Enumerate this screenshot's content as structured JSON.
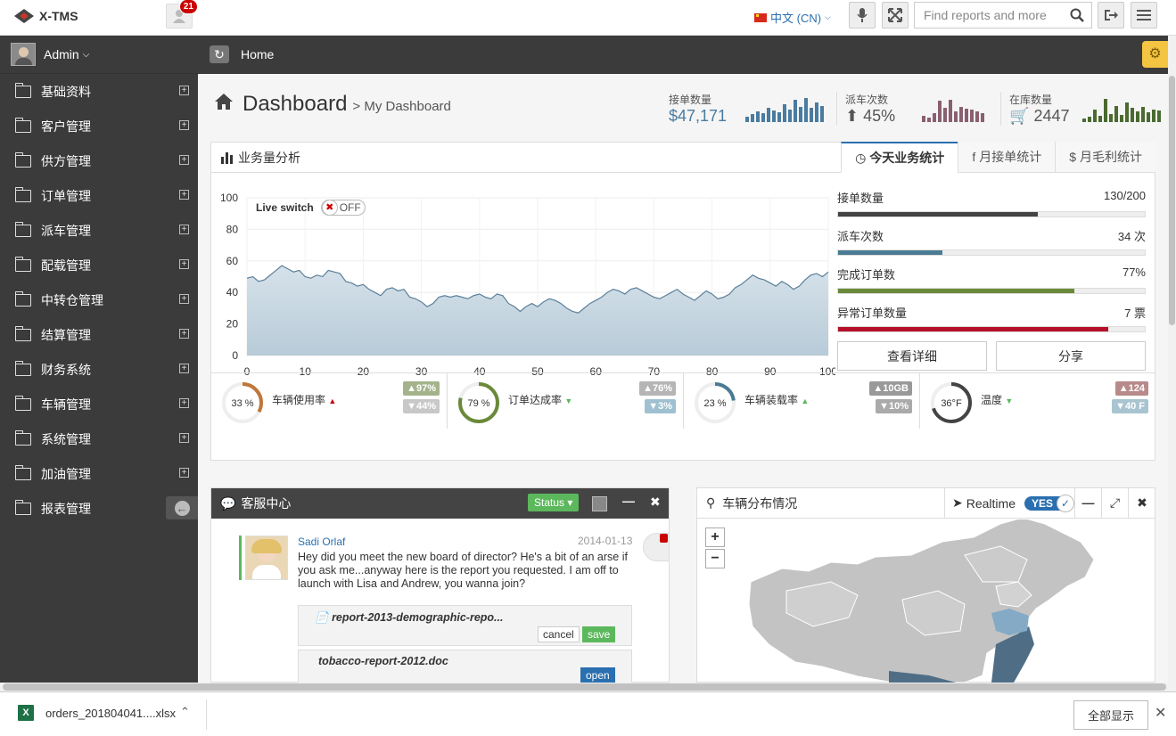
{
  "topbar": {
    "brand": "X-TMS",
    "notif_count": "21",
    "language": "中文 (CN)",
    "search_placeholder": "Find reports and more"
  },
  "sidebar": {
    "user": "Admin",
    "items": [
      {
        "label": "基础资料"
      },
      {
        "label": "客户管理"
      },
      {
        "label": "供方管理"
      },
      {
        "label": "订单管理"
      },
      {
        "label": "派车管理"
      },
      {
        "label": "配载管理"
      },
      {
        "label": "中转仓管理"
      },
      {
        "label": "结算管理"
      },
      {
        "label": "财务系统"
      },
      {
        "label": "车辆管理"
      },
      {
        "label": "系统管理"
      },
      {
        "label": "加油管理"
      },
      {
        "label": "报表管理"
      }
    ]
  },
  "breadcrumb": {
    "home": "Home"
  },
  "header": {
    "title": "Dashboard",
    "subtitle": "> My Dashboard",
    "stats": [
      {
        "label": "接单数量",
        "value": "$47,171"
      },
      {
        "label": "派车次数",
        "value": "45%"
      },
      {
        "label": "在库数量",
        "value": "2447"
      }
    ]
  },
  "panel": {
    "title": "业务量分析",
    "tabs": [
      {
        "label": "今天业务统计"
      },
      {
        "label": "月接单统计"
      },
      {
        "label": "月毛利统计"
      }
    ],
    "live_switch": "Live switch",
    "switch_state": "OFF"
  },
  "chart_data": {
    "type": "area",
    "xlim": [
      0,
      100
    ],
    "ylim": [
      0,
      100
    ],
    "x_ticks": [
      "0",
      "10",
      "20",
      "30",
      "40",
      "50",
      "60",
      "70",
      "80",
      "90",
      "100"
    ],
    "y_ticks": [
      "100",
      "80",
      "60",
      "40",
      "20",
      "0"
    ],
    "series": [
      {
        "values": [
          49,
          50,
          47,
          48,
          51,
          54,
          57,
          55,
          53,
          54,
          50,
          49,
          51,
          50,
          54,
          53,
          52,
          47,
          46,
          44,
          45,
          42,
          40,
          38,
          42,
          43,
          41,
          42,
          37,
          36,
          34,
          31,
          33,
          37,
          38,
          37,
          38,
          37,
          36,
          38,
          39,
          37,
          36,
          39,
          38,
          33,
          31,
          28,
          31,
          33,
          31,
          34,
          36,
          35,
          33,
          30,
          28,
          27,
          30,
          33,
          35,
          37,
          40,
          42,
          41,
          39,
          42,
          43,
          41,
          39,
          37,
          36,
          38,
          40,
          42,
          39,
          37,
          35,
          38,
          41,
          39,
          36,
          37,
          39,
          43,
          45,
          48,
          51,
          49,
          48,
          46,
          44,
          47,
          45,
          42,
          44,
          48,
          51,
          52,
          50,
          53
        ]
      }
    ]
  },
  "progress": [
    {
      "label": "接单数量",
      "value": "130/200",
      "pct": 0.65,
      "color": "#444444"
    },
    {
      "label": "派车次数",
      "value": "34 次",
      "pct": 0.34,
      "color": "#4a7b94"
    },
    {
      "label": "完成订单数",
      "value": "77%",
      "pct": 0.77,
      "color": "#6a8a3a"
    },
    {
      "label": "异常订单数量",
      "value": "7 票",
      "pct": 0.88,
      "color": "#b5102a"
    }
  ],
  "buttons": {
    "detail": "查看详细",
    "share": "分享"
  },
  "gauges": [
    {
      "value": "33 %",
      "label": "车辆使用率",
      "chip1": "97%",
      "chip2": "44%",
      "pct": 0.33,
      "color": "#c0763a"
    },
    {
      "value": "79 %",
      "label": "订单达成率",
      "chip1": "76%",
      "chip2": "3%",
      "pct": 0.79,
      "color": "#6a8a3a"
    },
    {
      "value": "23 %",
      "label": "车辆装载率",
      "chip1": "10GB",
      "chip2": "10%",
      "pct": 0.23,
      "color": "#4a7b94"
    },
    {
      "value": "36°F",
      "label": "温度",
      "chip1": "124",
      "chip2": "40 F",
      "pct": 0.7,
      "color": "#444444"
    }
  ],
  "chat": {
    "title": "客服中心",
    "status_label": "Status",
    "author": "Sadi Orlaf",
    "date": "2014-01-13",
    "message": "Hey did you meet the new board of director? He's a bit of an arse if you ask me...anyway here is the report you requested. I am off to launch with Lisa and Andrew, you wanna join?",
    "file1": "report-2013-demographic-repo...",
    "cancel": "cancel",
    "save": "save",
    "file2": "tobacco-report-2012.doc",
    "open": "open"
  },
  "map": {
    "title": "车辆分布情况",
    "realtime": "Realtime",
    "toggle": "YES",
    "zoom_in": "+",
    "zoom_out": "−"
  },
  "download": {
    "filename": "orders_201804041....xlsx",
    "show_all": "全部显示"
  }
}
